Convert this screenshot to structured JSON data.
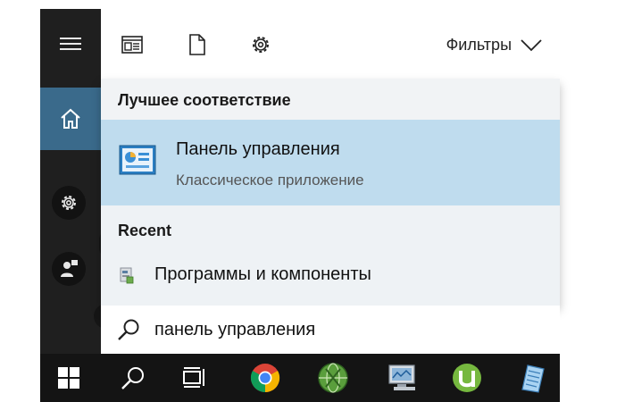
{
  "toolbar": {
    "filters_label": "Фильтры",
    "icons": [
      "apps-icon",
      "documents-icon",
      "settings-icon",
      "chevron-down-icon"
    ]
  },
  "results": {
    "best_match_header": "Лучшее соответствие",
    "best_match": {
      "title": "Панель управления",
      "subtitle": "Классическое приложение",
      "icon": "control-panel-icon"
    },
    "recent_header": "Recent",
    "recent_items": [
      {
        "label": "Программы и компоненты",
        "icon": "programs-features-icon"
      }
    ]
  },
  "search": {
    "value": "панель управления"
  },
  "rail": {
    "icons": [
      "hamburger-icon",
      "home-icon",
      "settings-icon",
      "user-icon"
    ]
  },
  "taskbar": {
    "icons": [
      "windows-start-icon",
      "search-icon",
      "task-view-icon",
      "chrome-icon",
      "globe-app-icon",
      "computer-app-icon",
      "utorrent-icon",
      "notepad-icon"
    ]
  },
  "colors": {
    "rail_bg": "#1f1f1f",
    "home_active": "#3a6a8b",
    "best_match_highlight": "#bfdcee",
    "taskbar_bg": "#141414"
  }
}
